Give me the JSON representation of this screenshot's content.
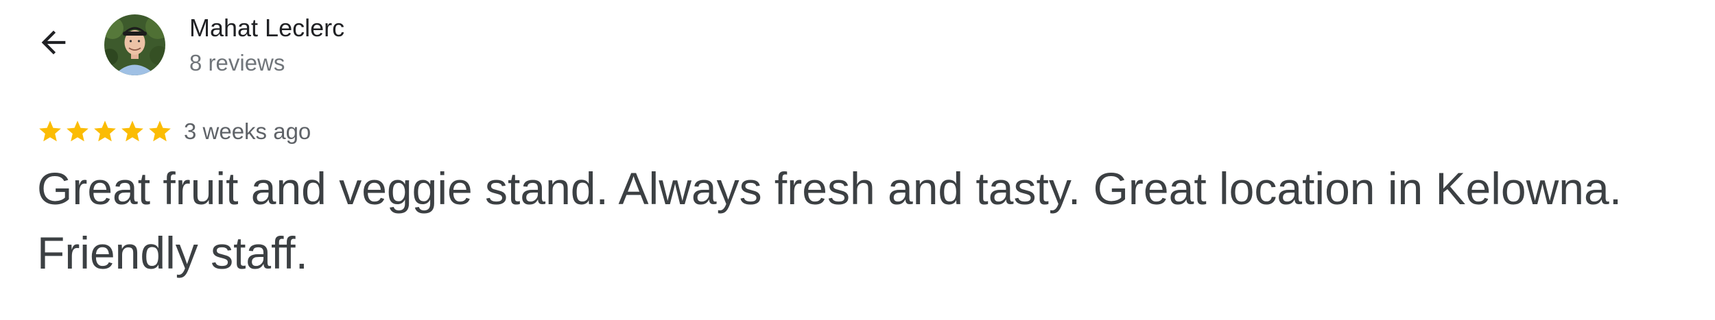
{
  "header": {
    "back_icon": "arrow-left-icon"
  },
  "reviewer": {
    "name": "Mahat Leclerc",
    "review_count": "8 reviews",
    "avatar": "reviewer-photo"
  },
  "review": {
    "rating": 5,
    "max_rating": 5,
    "star_icon": "star-icon",
    "star_color": "#fbbc04",
    "date": "3 weeks ago",
    "text": "Great fruit and veggie stand. Always fresh and tasty. Great location in Kelowna. Friendly staff."
  },
  "colors": {
    "primary_text": "#202124",
    "secondary_text": "#70757a",
    "body_text": "#3c4043"
  }
}
